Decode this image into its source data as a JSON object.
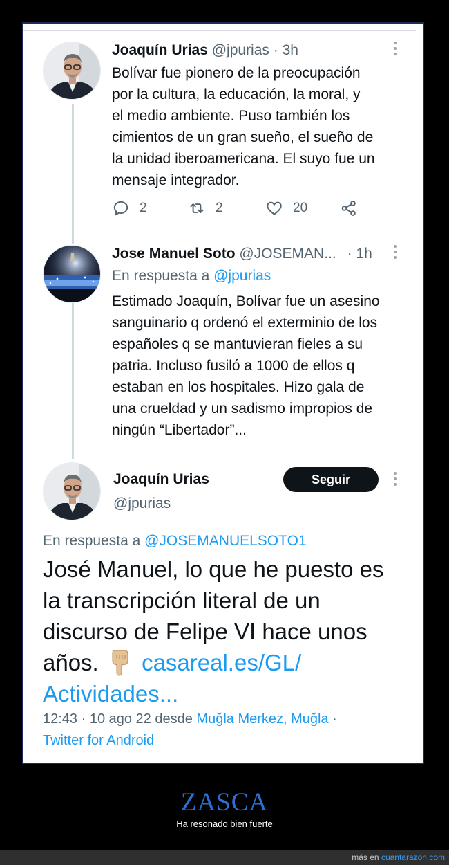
{
  "colors": {
    "twitter_blue": "#1d9bf0",
    "text": "#0f1419",
    "secondary": "#536471",
    "caption_blue": "#2b6fd6",
    "follow_bg": "#0f1419"
  },
  "tweet1": {
    "name": "Joaquín Urias",
    "handle": "@jpurias",
    "sep": "·",
    "time": "3h",
    "lines": [
      "Bolívar fue pionero de la preocupación",
      "por la cultura, la educación, la moral, y",
      "el medio ambiente. Puso también los",
      "cimientos de un gran sueño, el sueño de",
      "la unidad iberoamericana. El suyo fue un",
      "mensaje integrador."
    ],
    "replies": "2",
    "retweets": "2",
    "likes": "20",
    "icons": {
      "reply": "reply-icon",
      "retweet": "retweet-icon",
      "like": "heart-icon",
      "share": "share-icon",
      "more": "more-icon"
    }
  },
  "tweet2": {
    "name": "Jose Manuel Soto",
    "handle": "@JOSEMAN...",
    "sep": "·",
    "time": "1h",
    "reply_prefix": "En respuesta a",
    "reply_to": "@jpurias",
    "lines": [
      "Estimado Joaquín, Bolívar fue un asesino",
      "sanguinario q ordenó el exterminio de los",
      "españoles q se mantuvieran fieles a su",
      "patria. Incluso fusiló a 1000 de ellos q",
      "estaban en los hospitales. Hizo gala de",
      "una crueldad y un sadismo impropios de",
      "ningún “Libertador”..."
    ]
  },
  "tweet3": {
    "name": "Joaquín Urias",
    "handle": "@jpurias",
    "follow_label": "Seguir",
    "reply_prefix": "En respuesta a",
    "reply_to": "@JOSEMANUELSOTO1",
    "text_lines": [
      "José Manuel, lo que he puesto es",
      "la transcripción literal de un",
      "discurso de Felipe VI hace unos"
    ],
    "text_last": "años.",
    "emoji": "backhand-index-pointing-down-icon",
    "link_part1": "casareal.es/GL/",
    "link_part2": "Actividades...",
    "time": "12:43 · 10 ago 22 desde",
    "location": "Muğla Merkez, Muğla",
    "dot": "·",
    "client": "Twitter for Android"
  },
  "caption": {
    "title": "ZASCA",
    "subtitle": "Ha resonado bien fuerte"
  },
  "footer": {
    "prefix": "más en",
    "site": "cuantarazon.com"
  }
}
